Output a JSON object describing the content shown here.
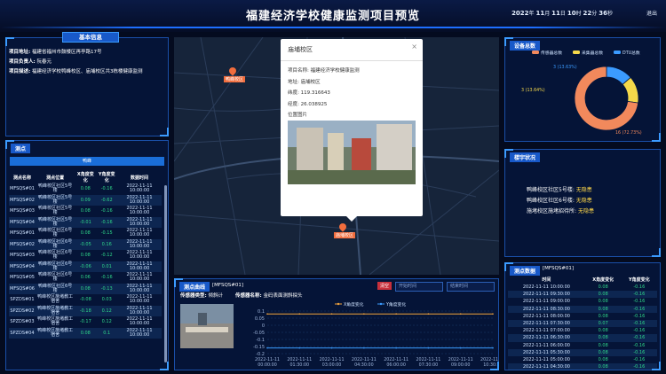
{
  "header": {
    "title": "福建经济学校健康监测项目预览",
    "time": {
      "year": "2022",
      "y": "年",
      "month": "11",
      "m": "月",
      "day": "11",
      "d": "日",
      "hour": "10",
      "h": "时",
      "minute": "22",
      "mi": "分",
      "second": "36",
      "s": "秒"
    },
    "logout": "退出"
  },
  "basic": {
    "tab": "基本信息",
    "rows": [
      {
        "k": "项目地址:",
        "v": "福建省福州市鼓楼区再亭路17号"
      },
      {
        "k": "项目负责人:",
        "v": "阮春元"
      },
      {
        "k": "项目描述:",
        "v": "福建经济学校鸭峰校区、庙埔校区共3栋楼健康监测"
      }
    ]
  },
  "points": {
    "title": "测点",
    "subtab": "鸭峰",
    "headers": [
      "测点名称",
      "测点位置",
      "X角度变化",
      "Y角度变化",
      "数据时间"
    ],
    "rows": [
      {
        "name": "MFSQS#01",
        "pos": "鸭峰校区社区5号楼",
        "x": "0.08",
        "y": "-0.16",
        "t": "2022-11-11 10:00:00"
      },
      {
        "name": "MFSQS#02",
        "pos": "鸭峰校区社区5号楼",
        "x": "0.09",
        "y": "-0.62",
        "t": "2022-11-11 10:00:00"
      },
      {
        "name": "MFSQS#03",
        "pos": "鸭峰校区社区5号楼",
        "x": "0.08",
        "y": "-0.16",
        "t": "2022-11-11 10:00:00"
      },
      {
        "name": "MFSQS#04",
        "pos": "鸭峰校区社区5号楼",
        "x": "-0.01",
        "y": "-0.16",
        "t": "2022-11-11 10:00:00"
      },
      {
        "name": "MFSQS#01",
        "pos": "鸭峰校区社区6号楼",
        "x": "0.08",
        "y": "-0.15",
        "t": "2022-11-11 10:00:00"
      },
      {
        "name": "MFSQS#02",
        "pos": "鸭峰校区社区6号楼",
        "x": "-0.05",
        "y": "0.16",
        "t": "2022-11-11 10:00:00"
      },
      {
        "name": "MFSQS#03",
        "pos": "鸭峰校区社区6号楼",
        "x": "0.08",
        "y": "-0.12",
        "t": "2022-11-11 10:00:00"
      },
      {
        "name": "MFSQS#04",
        "pos": "鸭峰校区社区6号楼",
        "x": "-0.06",
        "y": "0.01",
        "t": "2022-11-11 10:00:00"
      },
      {
        "name": "MFSQS#05",
        "pos": "鸭峰校区社区6号楼",
        "x": "0.06",
        "y": "-0.16",
        "t": "2022-11-11 10:00:00"
      },
      {
        "name": "MFSQS#06",
        "pos": "鸭峰校区社区6号楼",
        "x": "0.08",
        "y": "-0.13",
        "t": "2022-11-11 10:00:00"
      },
      {
        "name": "SPZDS#01",
        "pos": "鸭峰校区施堵教工宿舍",
        "x": "-0.08",
        "y": "0.03",
        "t": "2022-11-11 10:00:00"
      },
      {
        "name": "SPZDS#02",
        "pos": "鸭峰校区施堵教工宿舍",
        "x": "-0.18",
        "y": "0.12",
        "t": "2022-11-11 10:00:00"
      },
      {
        "name": "SPZDS#03",
        "pos": "鸭峰校区施堵教工宿舍",
        "x": "-0.17",
        "y": "0.12",
        "t": "2022-11-11 10:00:00"
      },
      {
        "name": "SPZDS#04",
        "pos": "鸭峰校区施堵教工宿舍",
        "x": "0.08",
        "y": "0.1",
        "t": "2022-11-11 10:00:00"
      }
    ]
  },
  "map": {
    "pins": [
      {
        "label": "鸭峰校区"
      },
      {
        "label": "庙埔校区"
      }
    ]
  },
  "popup": {
    "title": "庙埔校区",
    "rows": [
      {
        "k": "项目名称:",
        "v": "福建经济学校健康监测"
      },
      {
        "k": "地址:",
        "v": "庙埔校区"
      },
      {
        "k": "纬度:",
        "v": "119.316643"
      },
      {
        "k": "经度:",
        "v": "26.038925"
      },
      {
        "k": "位置图片",
        "v": ""
      }
    ],
    "close": "×"
  },
  "curve": {
    "title": "测点曲线",
    "code": "[MFSQS#01]",
    "sensor_type_k": "传感器类型:",
    "sensor_type_v": "倾斜计",
    "sensor_name_k": "传感器名称:",
    "sensor_name_v": "金码表面测斜探头",
    "clear": "清空",
    "start_ph": "开始时间",
    "end_ph": "结束时间",
    "legend": [
      "X角度变化",
      "Y角度变化"
    ]
  },
  "device": {
    "title": "设备总数",
    "legend": [
      "传感器总数",
      "采集器总数",
      "DTU总数"
    ],
    "labels": [
      "3 (13.63%)",
      "3 (13.64%)",
      "16 (72.73%)"
    ]
  },
  "building": {
    "title": "楼宇状况",
    "rows": [
      {
        "k": "鸭峰校区社区5号楼:",
        "v": "无隐患"
      },
      {
        "k": "鸭峰校区社区6号楼:",
        "v": "无隐患"
      },
      {
        "k": "施堵校区施堵招待所:",
        "v": "无隐患"
      }
    ]
  },
  "pointdata": {
    "title": "测点数据",
    "code": "[MFSQS#01]",
    "headers": [
      "时间",
      "X角度变化",
      "Y角度变化"
    ],
    "rows": [
      {
        "t": "2022-11-11 10:00:00",
        "x": "0.08",
        "y": "-0.16"
      },
      {
        "t": "2022-11-11 09:30:00",
        "x": "0.08",
        "y": "-0.16"
      },
      {
        "t": "2022-11-11 09:00:00",
        "x": "0.08",
        "y": "-0.16"
      },
      {
        "t": "2022-11-11 08:30:00",
        "x": "0.08",
        "y": "-0.16"
      },
      {
        "t": "2022-11-11 08:00:00",
        "x": "0.08",
        "y": "-0.16"
      },
      {
        "t": "2022-11-11 07:30:00",
        "x": "0.07",
        "y": "-0.16"
      },
      {
        "t": "2022-11-11 07:00:00",
        "x": "0.08",
        "y": "-0.16"
      },
      {
        "t": "2022-11-11 06:30:00",
        "x": "0.08",
        "y": "-0.16"
      },
      {
        "t": "2022-11-11 06:00:00",
        "x": "0.08",
        "y": "-0.16"
      },
      {
        "t": "2022-11-11 05:30:00",
        "x": "0.08",
        "y": "-0.16"
      },
      {
        "t": "2022-11-11 05:00:00",
        "x": "0.08",
        "y": "-0.16"
      },
      {
        "t": "2022-11-11 04:30:00",
        "x": "0.08",
        "y": "-0.16"
      }
    ]
  },
  "chart_data": [
    {
      "type": "line",
      "title": "",
      "xlabel": "",
      "ylabel": "",
      "x": [
        "2022-11-11 00:00:00",
        "2022-11-11 01:30:00",
        "2022-11-11 03:00:00",
        "2022-11-11 04:30:00",
        "2022-11-11 06:00:00",
        "2022-11-11 07:30:00",
        "2022-11-11 09:00:00",
        "2022-11-11 10:30:00"
      ],
      "series": [
        {
          "name": "X角度变化",
          "values": [
            0.08,
            0.08,
            0.08,
            0.08,
            0.08,
            0.08,
            0.08,
            0.08
          ]
        },
        {
          "name": "Y角度变化",
          "values": [
            -0.16,
            -0.16,
            -0.16,
            -0.16,
            -0.16,
            -0.16,
            -0.16,
            -0.16
          ]
        }
      ],
      "yticks": [
        "0.1",
        "0.05",
        "0",
        "-0.05",
        "-0.1",
        "-0.15",
        "-0.2"
      ],
      "ylim": [
        -0.2,
        0.1
      ],
      "legend": "top-center"
    },
    {
      "type": "pie",
      "categories": [
        "传感器总数",
        "采集器总数",
        "DTU总数"
      ],
      "values": [
        16,
        3,
        3
      ],
      "percent": [
        72.73,
        13.64,
        13.63
      ],
      "colors": [
        "#f2895c",
        "#f5d94a",
        "#3b9bff"
      ],
      "legend": "top"
    }
  ]
}
